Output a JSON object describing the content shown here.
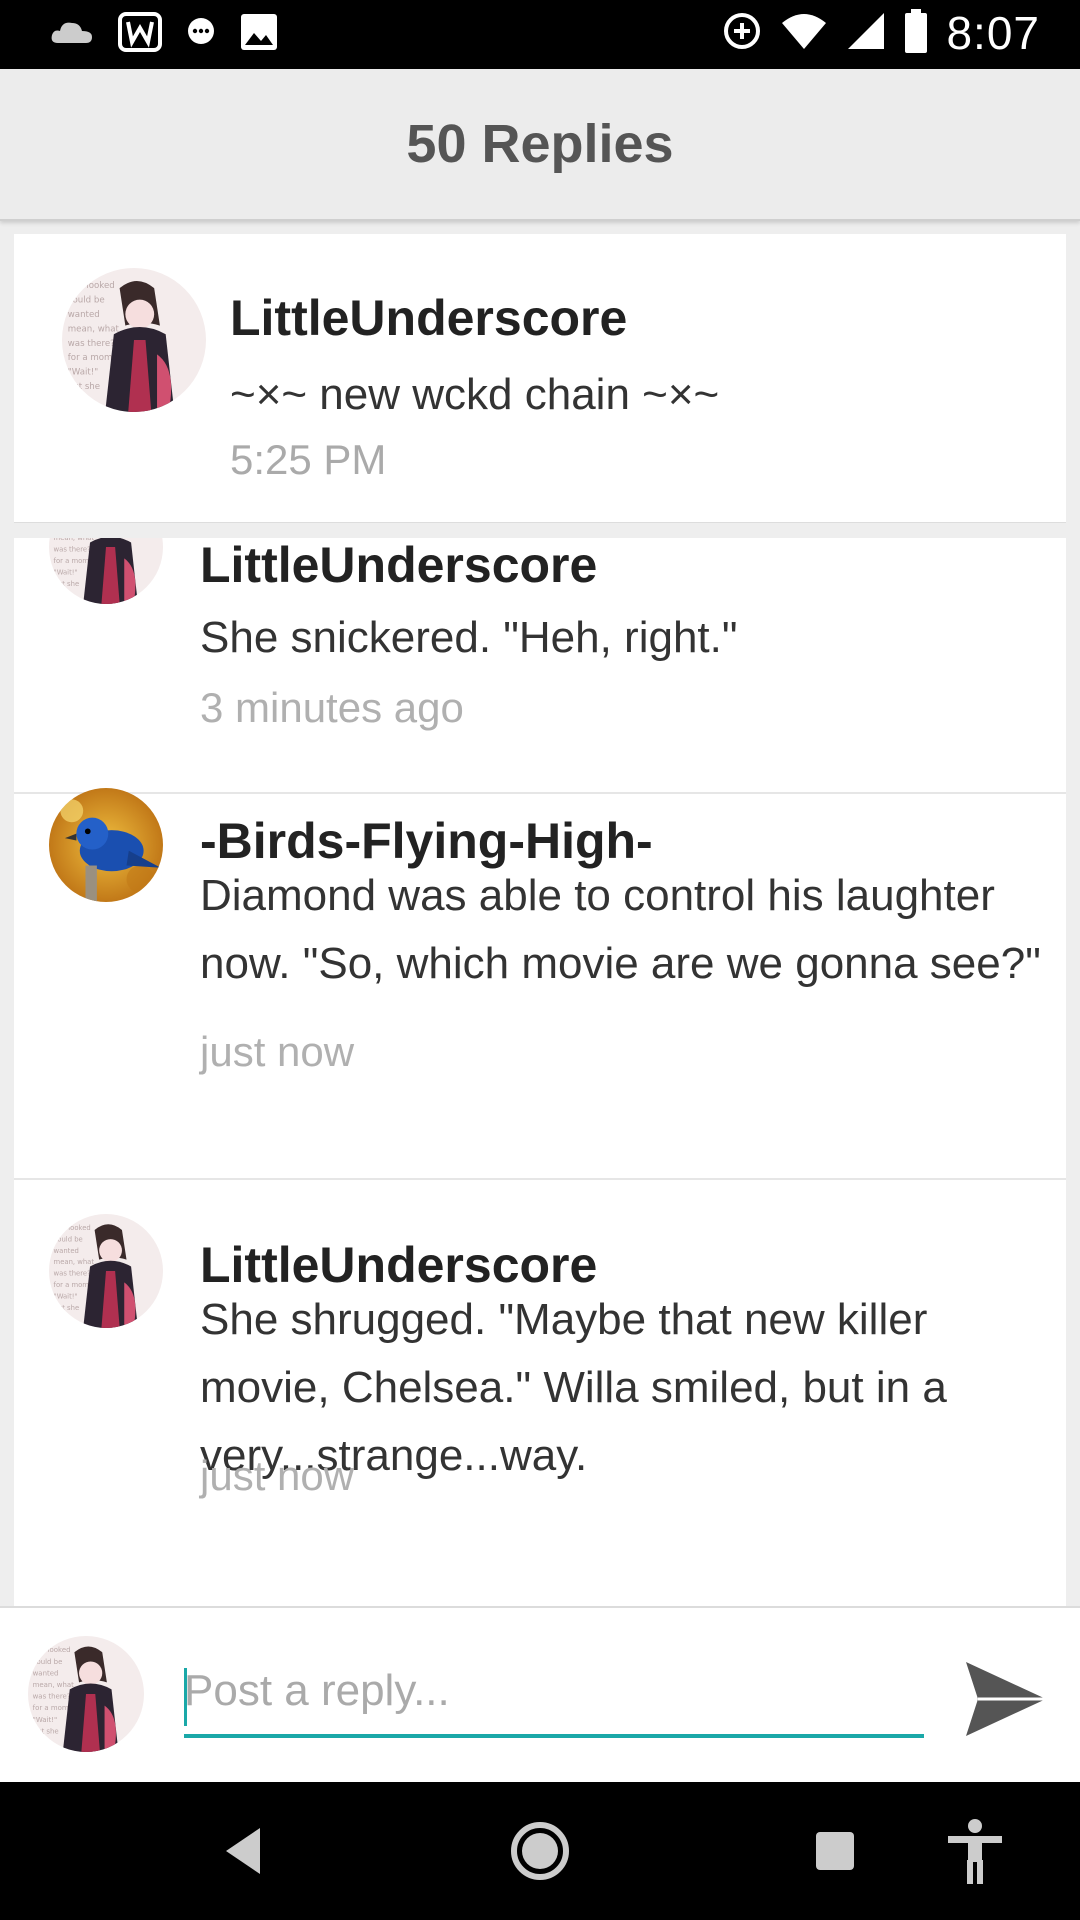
{
  "status_bar": {
    "time": "8:07",
    "icons": [
      "cloud-icon",
      "wattpad-icon",
      "chat-bubble-icon",
      "image-icon",
      "data-saver-icon",
      "wifi-icon",
      "cell-signal-icon",
      "battery-icon"
    ]
  },
  "header": {
    "title": "50 Replies"
  },
  "original_post": {
    "author": "LittleUnderscore",
    "title": "~×~ new wckd chain ~×~",
    "time": "5:25 PM"
  },
  "replies": [
    {
      "author": "LittleUnderscore",
      "text": "She snickered. \"Heh, right.\"",
      "time": "3 minutes ago",
      "avatar": "anime-girl-avatar"
    },
    {
      "author": "-Birds-Flying-High-",
      "text": "Diamond was able to control his laughter now. \"So, which movie are we gonna see?\"",
      "time": "just now",
      "avatar": "blue-bird-avatar"
    },
    {
      "author": "LittleUnderscore",
      "text": "She shrugged. \"Maybe that new killer movie, Chelsea.\" Willa smiled, but in a very...strange...way.",
      "time": "just now",
      "avatar": "anime-girl-avatar"
    }
  ],
  "composer": {
    "placeholder": "Post a reply...",
    "value": ""
  },
  "colors": {
    "accent": "#1aa8a8",
    "header_bg": "#ececec",
    "muted_text": "#aaaaaa"
  },
  "nav_bar": {
    "icons": [
      "back-icon",
      "home-icon",
      "recents-icon",
      "accessibility-icon"
    ]
  }
}
